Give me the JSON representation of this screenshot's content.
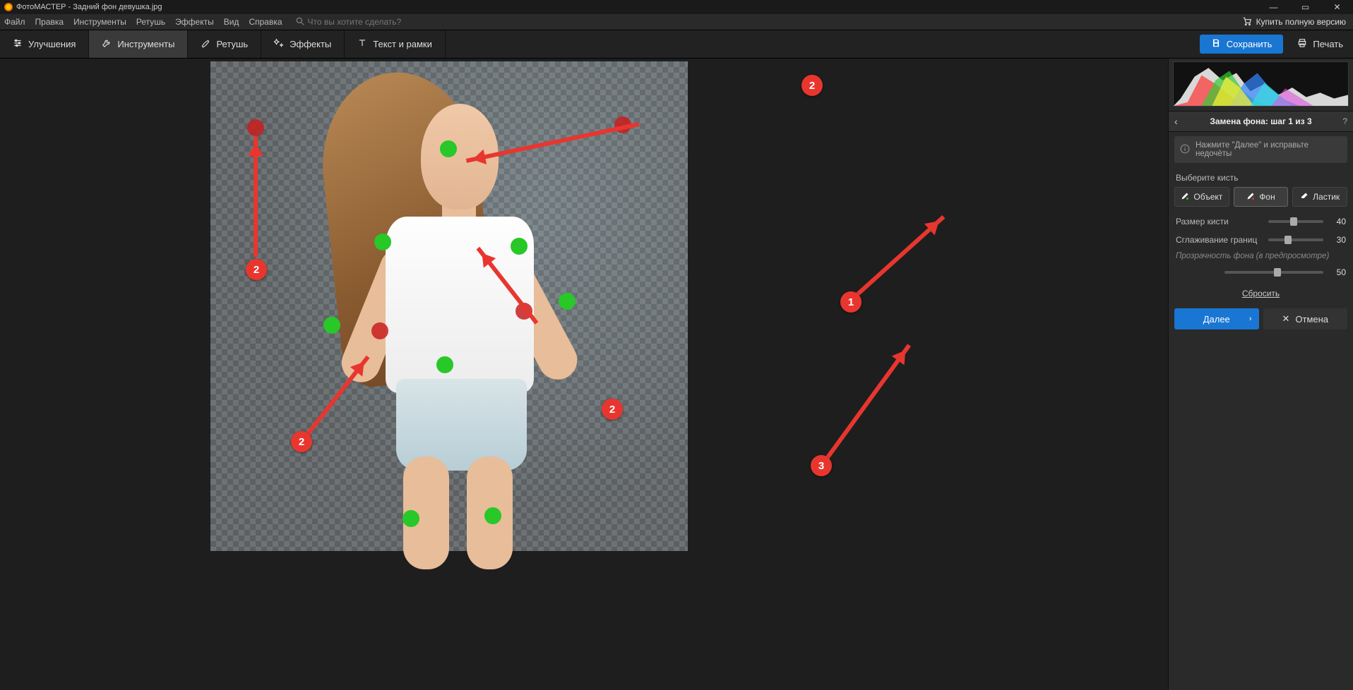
{
  "window": {
    "title": "ФотоМАСТЕР - Задний фон девушка.jpg"
  },
  "menu": {
    "items": [
      "Файл",
      "Правка",
      "Инструменты",
      "Ретушь",
      "Эффекты",
      "Вид",
      "Справка"
    ],
    "search_placeholder": "Что вы хотите сделать?",
    "buy_full": "Купить полную версию"
  },
  "toolbar": {
    "tabs": [
      {
        "label": "Улучшения",
        "icon": "sliders-icon"
      },
      {
        "label": "Инструменты",
        "icon": "wrench-icon"
      },
      {
        "label": "Ретушь",
        "icon": "brush-icon"
      },
      {
        "label": "Эффекты",
        "icon": "sparkle-icon"
      },
      {
        "label": "Текст и рамки",
        "icon": "text-icon"
      }
    ],
    "active_index": 1,
    "save_label": "Сохранить",
    "print_label": "Печать"
  },
  "panel": {
    "step_title": "Замена фона: шаг 1 из 3",
    "info": "Нажмите \"Далее\" и исправьте недочёты",
    "choose_brush": "Выберите кисть",
    "brushes": [
      {
        "label": "Объект",
        "icon": "object-brush-icon"
      },
      {
        "label": "Фон",
        "icon": "bg-brush-icon"
      },
      {
        "label": "Ластик",
        "icon": "eraser-icon"
      }
    ],
    "active_brush": 1,
    "sliders": {
      "size": {
        "label": "Размер кисти",
        "value": 40,
        "min": 0,
        "max": 100
      },
      "smooth": {
        "label": "Сглаживание границ",
        "value": 30,
        "min": 0,
        "max": 100
      }
    },
    "opacity_hint_label": "Прозрачность фона",
    "opacity_hint_note": "(в предпросмотре)",
    "opacity": {
      "value": 50,
      "min": 0,
      "max": 100
    },
    "reset": "Сбросить",
    "next": "Далее",
    "cancel": "Отмена"
  },
  "annotations": {
    "badge1": "1",
    "badge2": "2",
    "badge3": "3"
  }
}
